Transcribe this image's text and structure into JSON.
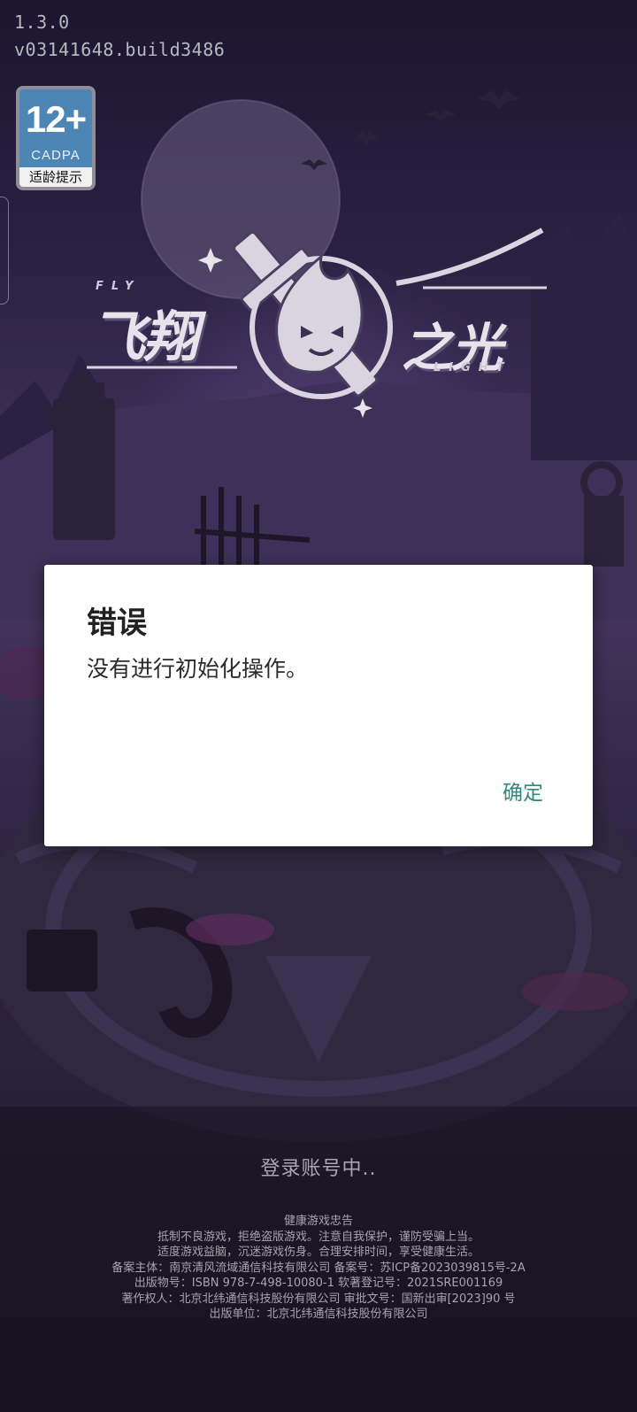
{
  "version": {
    "number": "1.3.0",
    "build": "v03141648.build3486"
  },
  "age_rating": {
    "value": "12+",
    "org": "CADPA",
    "caption": "适龄提示"
  },
  "logo": {
    "title_left": "飞翔",
    "title_right": "之光",
    "en_left": "FLY",
    "en_right": "LIGHT"
  },
  "dialog": {
    "title": "错误",
    "message": "没有进行初始化操作。",
    "confirm_label": "确定"
  },
  "status": {
    "login": "登录账号中.."
  },
  "footer": {
    "heading": "健康游戏忠告",
    "advice_1": "抵制不良游戏，拒绝盗版游戏。注意自我保护，谨防受骗上当。",
    "advice_2": "适度游戏益脑，沉迷游戏伤身。合理安排时间，享受健康生活。",
    "filing": "备案主体：南京清风流域通信科技有限公司 备案号：苏ICP备2023039815号-2A",
    "publication": "出版物号：ISBN 978-7-498-10080-1 软著登记号：2021SRE001169",
    "copyright": "著作权人：北京北纬通信科技股份有限公司 审批文号：国新出审[2023]90 号",
    "publisher": "出版单位：北京北纬通信科技股份有限公司"
  },
  "colors": {
    "dialog_button": "#2f8a7d",
    "badge_blue": "#4d86b5",
    "background": "#2a2142"
  }
}
